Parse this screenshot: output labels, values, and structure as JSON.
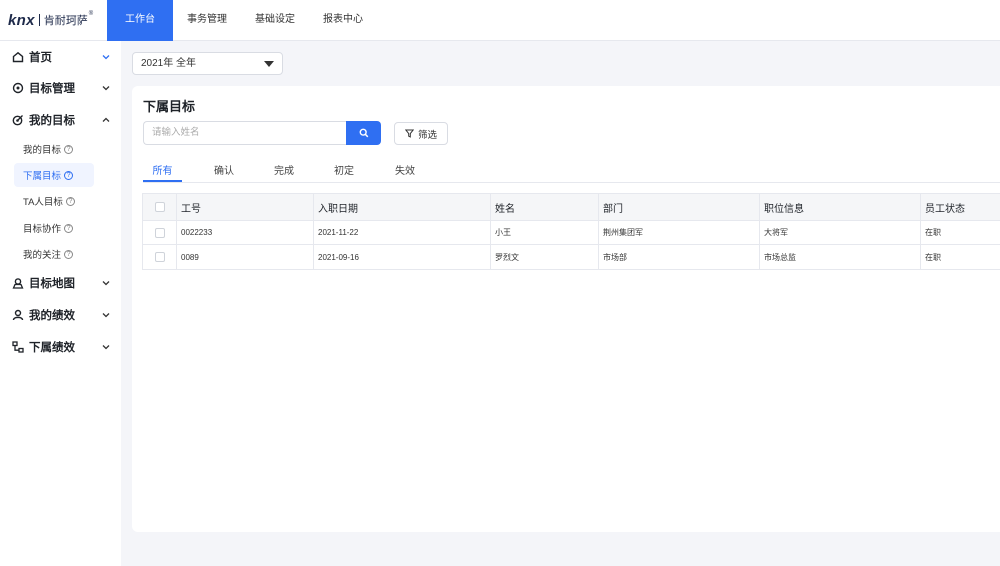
{
  "logo": {
    "brand": "knx",
    "name": "肯耐珂萨",
    "reg": "®"
  },
  "topnav": [
    "工作台",
    "事务管理",
    "基础设定",
    "报表中心"
  ],
  "sidebar": {
    "home": "首页",
    "goal_mgmt": "目标管理",
    "my_goals": "我的目标",
    "sub": [
      "我的目标",
      "下属目标",
      "TA人目标",
      "目标协作",
      "我的关注"
    ],
    "goal_map": "目标地图",
    "my_perf": "我的绩效",
    "sub_perf": "下属绩效"
  },
  "year_select": "2021年 全年",
  "card": {
    "title": "下属目标",
    "search_placeholder": "请输入姓名",
    "filter_label": "筛选",
    "tabs": [
      "所有",
      "确认",
      "完成",
      "初定",
      "失效"
    ]
  },
  "table": {
    "headers": [
      "工号",
      "入职日期",
      "姓名",
      "部门",
      "职位信息",
      "员工状态"
    ],
    "rows": [
      [
        "0022233",
        "2021-11-22",
        "小王",
        "荆州集团军",
        "大将军",
        "在职"
      ],
      [
        "0089",
        "2021-09-16",
        "罗烈文",
        "市场部",
        "市场总监",
        "在职"
      ]
    ]
  },
  "colors": {
    "accent": "#2f6ff2",
    "page_bg": "#f4f5f9"
  }
}
